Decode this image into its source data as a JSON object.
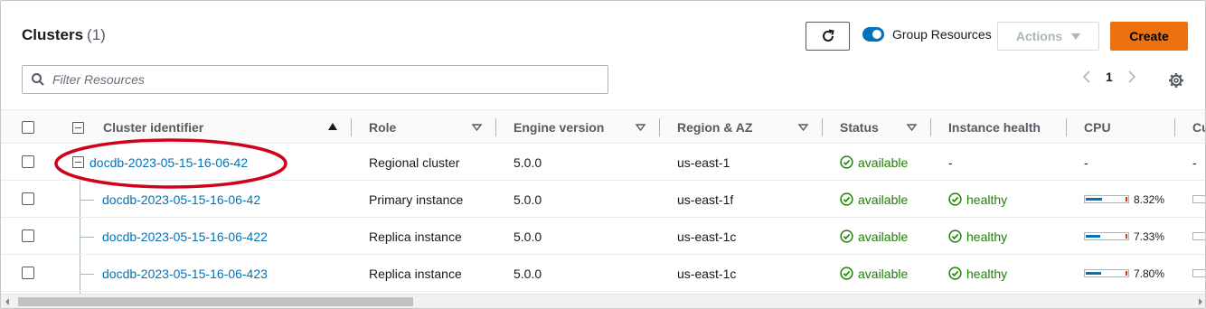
{
  "header": {
    "title": "Clusters",
    "count": "(1)",
    "group_resources_label": "Group Resources",
    "group_resources_on": true,
    "actions_label": "Actions",
    "create_label": "Create"
  },
  "filter": {
    "placeholder": "Filter Resources",
    "value": ""
  },
  "pagination": {
    "current_page": "1"
  },
  "columns": [
    {
      "label": "Cluster identifier",
      "sort": "ascending"
    },
    {
      "label": "Role",
      "sort": "none"
    },
    {
      "label": "Engine version",
      "sort": "none"
    },
    {
      "label": "Region & AZ",
      "sort": "none"
    },
    {
      "label": "Status",
      "sort": "none"
    },
    {
      "label": "Instance health"
    },
    {
      "label": "CPU"
    },
    {
      "label": "Cu"
    }
  ],
  "rows": [
    {
      "identifier": "docdb-2023-05-15-16-06-42",
      "role": "Regional cluster",
      "engine": "5.0.0",
      "region": "us-east-1",
      "status": "available",
      "health": "-",
      "cpu": "-",
      "cu": "-",
      "cpu_level": null
    },
    {
      "identifier": "docdb-2023-05-15-16-06-42",
      "role": "Primary instance",
      "engine": "5.0.0",
      "region": "us-east-1f",
      "status": "available",
      "health": "healthy",
      "cpu": "8.32%",
      "cpu_level": 0.0832
    },
    {
      "identifier": "docdb-2023-05-15-16-06-422",
      "role": "Replica instance",
      "engine": "5.0.0",
      "region": "us-east-1c",
      "status": "available",
      "health": "healthy",
      "cpu": "7.33%",
      "cpu_level": 0.0733
    },
    {
      "identifier": "docdb-2023-05-15-16-06-423",
      "role": "Replica instance",
      "engine": "5.0.0",
      "region": "us-east-1c",
      "status": "available",
      "health": "healthy",
      "cpu": "7.80%",
      "cpu_level": 0.078
    }
  ],
  "icons": {
    "refresh": "refresh-icon",
    "search": "search-icon",
    "settings": "gear-icon",
    "status_ok": "check-circle-icon"
  },
  "colors": {
    "accent": "#0073bb",
    "primary_button": "#ec7211",
    "success": "#1d8102",
    "annotation": "#d0021b"
  }
}
